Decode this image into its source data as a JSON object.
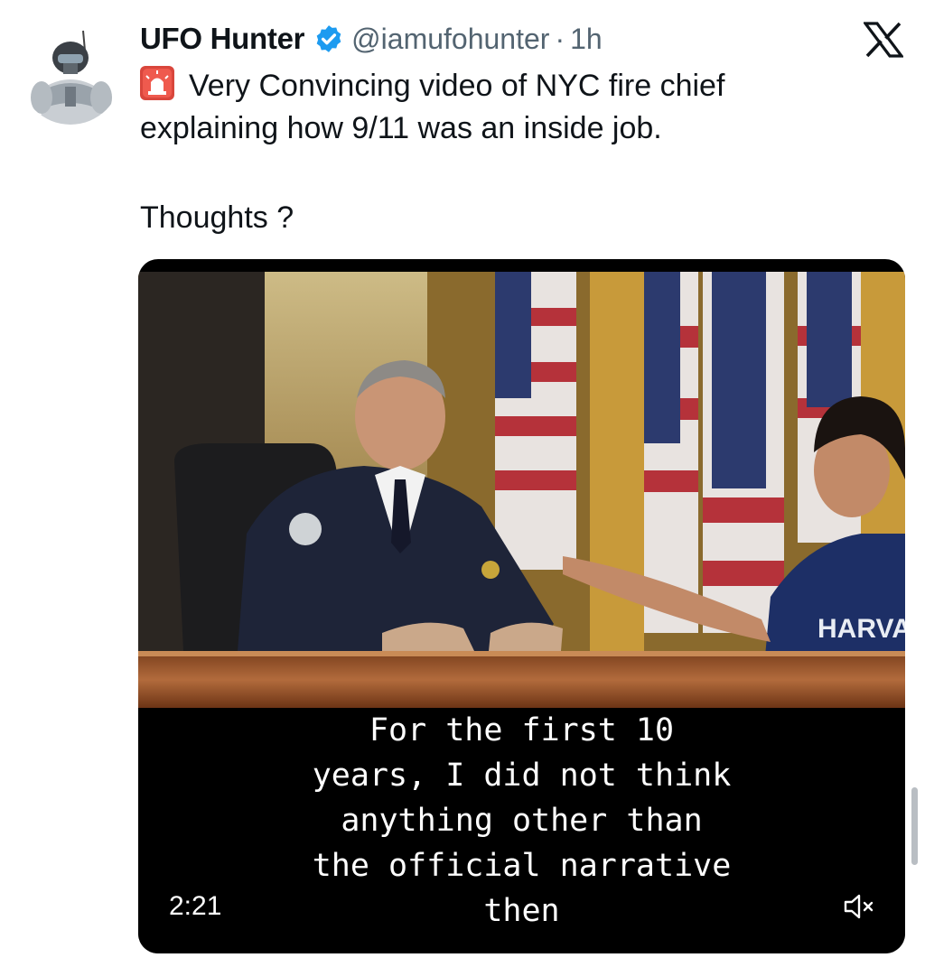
{
  "author": {
    "name": "UFO Hunter",
    "handle": "@iamufohunter",
    "separator": "·",
    "time": "1h",
    "verified_color": "#1d9bf0"
  },
  "tweet": {
    "emoji_icon": "siren-icon",
    "lines": [
      "Very Convincing video of NYC fire chief",
      "explaining how 9/11 was an inside job.",
      "Thoughts ?"
    ]
  },
  "media": {
    "caption_lines": [
      "For the first 10",
      "years, I did not think",
      "anything other than",
      "the official narrative",
      "then"
    ],
    "duration": "2:21",
    "mute_icon": "speaker-muted-icon",
    "shirt_text": "HARVARD"
  },
  "brand": {
    "logo": "x-logo-icon"
  },
  "colors": {
    "text": "#0f1419",
    "secondary": "#536471",
    "accent": "#1d9bf0"
  }
}
